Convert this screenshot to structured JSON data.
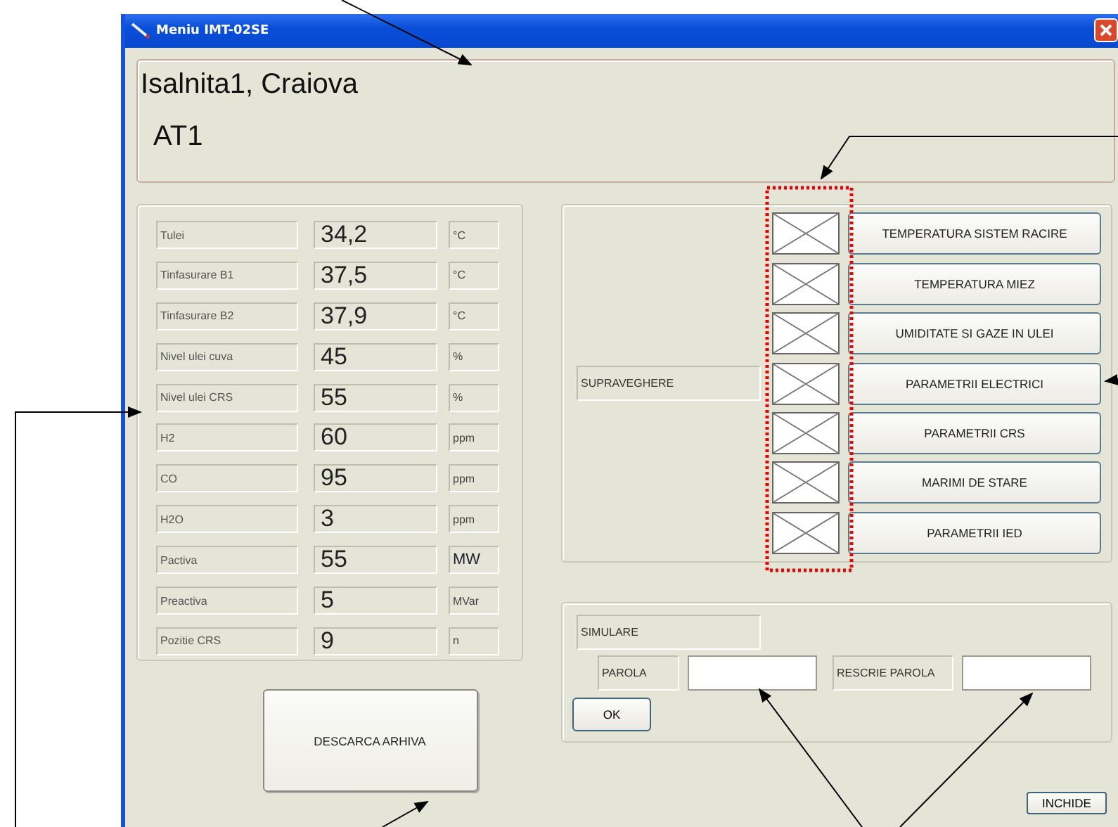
{
  "window": {
    "title": "Meniu IMT-02SE"
  },
  "header": {
    "station": "Isalnita1, Craiova",
    "unit": "AT1"
  },
  "measurements": [
    {
      "label": "Tulei",
      "value": "34,2",
      "unit": "°C"
    },
    {
      "label": "Tinfasurare B1",
      "value": "37,5",
      "unit": "°C"
    },
    {
      "label": "Tinfasurare B2",
      "value": "37,9",
      "unit": "°C"
    },
    {
      "label": "Nivel ulei cuva",
      "value": "45",
      "unit": "%"
    },
    {
      "label": "Nivel ulei CRS",
      "value": "55",
      "unit": "%"
    },
    {
      "label": "H2",
      "value": "60",
      "unit": "ppm"
    },
    {
      "label": "CO",
      "value": "95",
      "unit": "ppm"
    },
    {
      "label": "H2O",
      "value": "3",
      "unit": "ppm"
    },
    {
      "label": "Pactiva",
      "value": "55",
      "unit": "MW"
    },
    {
      "label": "Preactiva",
      "value": "5",
      "unit": "MVar"
    },
    {
      "label": "Pozitie CRS",
      "value": "9",
      "unit": "n"
    }
  ],
  "download_button": "DESCARCA ARHIVA",
  "monitoring": {
    "label": "SUPRAVEGHERE",
    "buttons": [
      "TEMPERATURA SISTEM RACIRE",
      "TEMPERATURA MIEZ",
      "UMIDITATE SI GAZE IN ULEI",
      "PARAMETRII ELECTRICI",
      "PARAMETRII CRS",
      "MARIMI DE STARE",
      "PARAMETRII IED"
    ]
  },
  "simulation": {
    "label": "SIMULARE",
    "password_label": "PAROLA",
    "retype_label": "RESCRIE PAROLA",
    "ok_button": "OK"
  },
  "close_button": "INCHIDE"
}
